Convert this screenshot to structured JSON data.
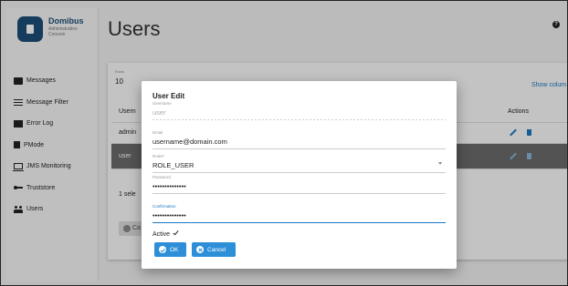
{
  "brand": {
    "name": "Domibus",
    "subtitle": "Administration Console"
  },
  "sidebar": {
    "items": [
      {
        "label": "Messages",
        "icon": "messages-icon"
      },
      {
        "label": "Message Filter",
        "icon": "filter-icon"
      },
      {
        "label": "Error Log",
        "icon": "error-log-icon"
      },
      {
        "label": "PMode",
        "icon": "pmode-icon"
      },
      {
        "label": "JMS Monitoring",
        "icon": "monitor-icon"
      },
      {
        "label": "Truststore",
        "icon": "key-icon"
      },
      {
        "label": "Users",
        "icon": "users-icon"
      }
    ]
  },
  "header": {
    "title": "Users",
    "help_icon": "help-icon"
  },
  "table": {
    "rows_label": "Rows",
    "rows_value": "10",
    "show_columns": "Show colum",
    "header_col1": "Usern",
    "header_actions": "Actions",
    "rows": [
      {
        "col1": "admin"
      },
      {
        "col1": "user",
        "selected": true
      }
    ],
    "selected_info": "1 sele",
    "button_label": "Ca"
  },
  "dialog": {
    "title": "User Edit",
    "fields": {
      "username": {
        "label": "Username",
        "value": "user"
      },
      "email": {
        "label": "Email",
        "value": "username@domain.com"
      },
      "role": {
        "label": "Roles*",
        "value": "ROLE_USER"
      },
      "password": {
        "label": "Password",
        "value": "••••••••••••••"
      },
      "confirmation": {
        "label": "Confirmation",
        "value": "••••••••••••••"
      }
    },
    "active_label": "Active",
    "active_checked": true,
    "ok_label": "OK",
    "cancel_label": "Cancel"
  },
  "colors": {
    "accent": "#2d8fd8",
    "link": "#1a78c2",
    "brand": "#1d4e78",
    "selected_row": "#6b6b6b"
  }
}
